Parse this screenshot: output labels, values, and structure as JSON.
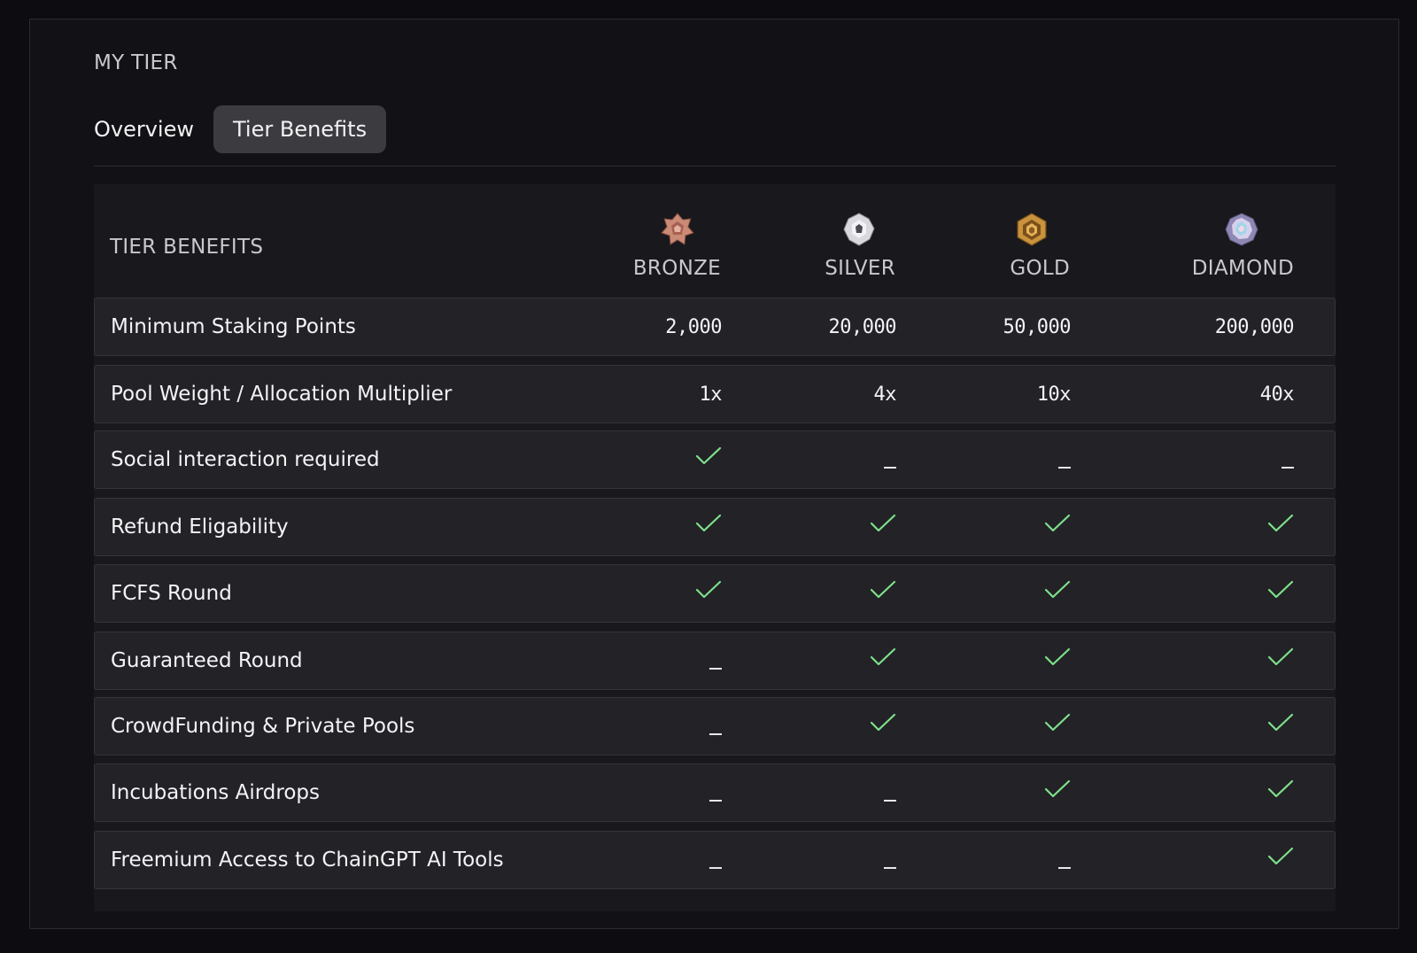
{
  "section_title": "MY TIER",
  "tabs": [
    {
      "label": "Overview",
      "active": false
    },
    {
      "label": "Tier Benefits",
      "active": true
    }
  ],
  "table": {
    "header_label": "TIER BENEFITS",
    "tiers": [
      {
        "name": "BRONZE",
        "icon": "bronze-tier-icon",
        "color": "#c98a76"
      },
      {
        "name": "SILVER",
        "icon": "silver-tier-icon",
        "color": "#d0d0d6"
      },
      {
        "name": "GOLD",
        "icon": "gold-tier-icon",
        "color": "#c9923c"
      },
      {
        "name": "DIAMOND",
        "icon": "diamond-tier-icon",
        "color": "#b9b2d4"
      }
    ],
    "rows": [
      {
        "label": "Minimum Staking Points",
        "values": [
          "2,000",
          "20,000",
          "50,000",
          "200,000"
        ]
      },
      {
        "label": "Pool Weight / Allocation Multiplier",
        "values": [
          "1x",
          "4x",
          "10x",
          "40x"
        ]
      },
      {
        "label": "Social interaction required",
        "values": [
          "check",
          "dash",
          "dash",
          "dash"
        ]
      },
      {
        "label": "Refund Eligability",
        "values": [
          "check",
          "check",
          "check",
          "check"
        ]
      },
      {
        "label": "FCFS Round",
        "values": [
          "check",
          "check",
          "check",
          "check"
        ]
      },
      {
        "label": "Guaranteed Round",
        "values": [
          "dash",
          "check",
          "check",
          "check"
        ]
      },
      {
        "label": "CrowdFunding & Private Pools",
        "values": [
          "dash",
          "check",
          "check",
          "check"
        ]
      },
      {
        "label": "Incubations Airdrops",
        "values": [
          "dash",
          "dash",
          "check",
          "check"
        ]
      },
      {
        "label": "Freemium Access to ChainGPT AI Tools",
        "values": [
          "dash",
          "dash",
          "dash",
          "check"
        ]
      }
    ]
  },
  "colors": {
    "check": "#7ee08a",
    "background": "#0c0c11",
    "panel": "#121216",
    "row": "#222227"
  }
}
